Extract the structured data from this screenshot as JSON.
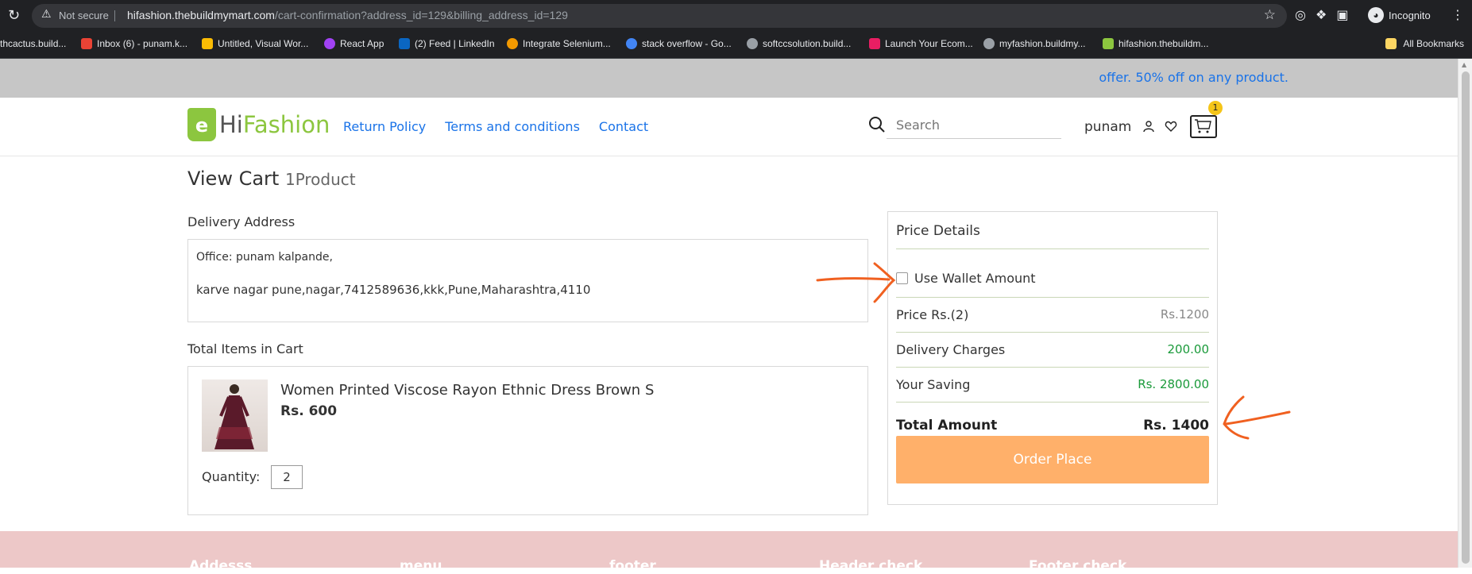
{
  "browser": {
    "security_label": "Not secure",
    "url_host": "hifashion.thebuildmymart.com",
    "url_path": "/cart-confirmation?address_id=129&billing_address_id=129",
    "profile_label": "Incognito",
    "bookmarks": [
      {
        "label": "rthcactus.build...",
        "color": "#9aa0a6"
      },
      {
        "label": "Inbox (6) - punam.k...",
        "color": "#ea4335"
      },
      {
        "label": "Untitled, Visual Wor...",
        "color": "#fbbc04"
      },
      {
        "label": "React App",
        "color": "#a142f4"
      },
      {
        "label": "(2) Feed | LinkedIn",
        "color": "#0a66c2"
      },
      {
        "label": "Integrate Selenium...",
        "color": "#f29900"
      },
      {
        "label": "stack overflow - Go...",
        "color": "#4285f4"
      },
      {
        "label": "softccsolution.build...",
        "color": "#9aa0a6"
      },
      {
        "label": "Launch Your Ecom...",
        "color": "#e91e63"
      },
      {
        "label": "myfashion.buildmy...",
        "color": "#9aa0a6"
      },
      {
        "label": "hifashion.thebuildm...",
        "color": "#8cc63f"
      }
    ],
    "all_bookmarks_label": "All Bookmarks"
  },
  "offer": {
    "text": "offer. 50% off on any product."
  },
  "header": {
    "logo_e": "e",
    "logo_hi": "Hi",
    "logo_fashion": "Fashion",
    "nav_links": [
      "Return Policy",
      "Terms and conditions",
      "Contact"
    ],
    "search_placeholder": "Search",
    "username": "punam",
    "cart_count": "1"
  },
  "cart": {
    "title": "View Cart",
    "product_count": "1Product",
    "delivery_address_label": "Delivery Address",
    "address_name": "Office: punam kalpande,",
    "address_line": "karve nagar pune,nagar,7412589636,kkk,Pune,Maharashtra,4110",
    "total_items_label": "Total Items in Cart",
    "item": {
      "name": "Women Printed Viscose Rayon Ethnic Dress Brown S",
      "price": "Rs. 600",
      "quantity_label": "Quantity:",
      "quantity": "2"
    }
  },
  "price_details": {
    "title": "Price Details",
    "wallet_label": "Use Wallet Amount",
    "wallet_checked": false,
    "price_label": "Price Rs.(2)",
    "price_value": "Rs.1200",
    "delivery_label": "Delivery Charges",
    "delivery_value": "200.00",
    "saving_label": "Your Saving",
    "saving_value": "Rs. 2800.00",
    "total_label": "Total Amount",
    "total_value": "Rs. 1400",
    "order_button": "Order Place"
  },
  "footer": {
    "columns": [
      "Addesss",
      "menu",
      "footer",
      "Header check",
      "Footer check"
    ]
  },
  "colors": {
    "accent_blue": "#1a73e8",
    "brand_green": "#8cc63f",
    "order_button": "#ffb06a",
    "value_green": "#1a9a3a",
    "annotation_arrow": "#f06020",
    "footer_bg": "#edc8c8"
  }
}
